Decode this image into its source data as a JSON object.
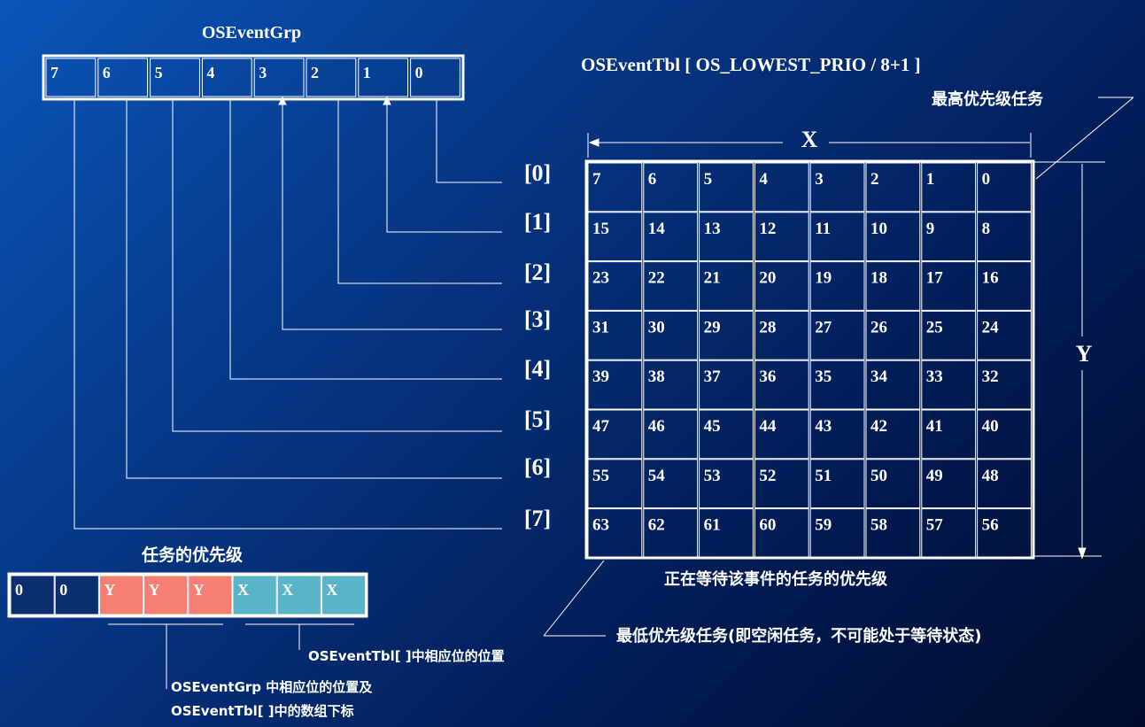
{
  "grp": {
    "title": "OSEventGrp",
    "bits": [
      "7",
      "6",
      "5",
      "4",
      "3",
      "2",
      "1",
      "0"
    ]
  },
  "tbl": {
    "title": "OSEventTbl [ OS_LOWEST_PRIO / 8+1 ]",
    "x_label": "X",
    "y_label": "Y",
    "row_labels": [
      "[0]",
      "[1]",
      "[2]",
      "[3]",
      "[4]",
      "[5]",
      "[6]",
      "[7]"
    ],
    "cells": [
      [
        "7",
        "6",
        "5",
        "4",
        "3",
        "2",
        "1",
        "0"
      ],
      [
        "15",
        "14",
        "13",
        "12",
        "11",
        "10",
        "9",
        "8"
      ],
      [
        "23",
        "22",
        "21",
        "20",
        "19",
        "18",
        "17",
        "16"
      ],
      [
        "31",
        "30",
        "29",
        "28",
        "27",
        "26",
        "25",
        "24"
      ],
      [
        "39",
        "38",
        "37",
        "36",
        "35",
        "34",
        "33",
        "32"
      ],
      [
        "47",
        "46",
        "45",
        "44",
        "43",
        "42",
        "41",
        "40"
      ],
      [
        "55",
        "54",
        "53",
        "52",
        "51",
        "50",
        "49",
        "48"
      ],
      [
        "63",
        "62",
        "61",
        "60",
        "59",
        "58",
        "57",
        "56"
      ]
    ],
    "highest_label": "最高优先级任务",
    "waiting_label": "正在等待该事件的任务的优先级",
    "lowest_label": "最低优先级任务(即空闲任务，不可能处于等待状态)"
  },
  "prio": {
    "title": "任务的优先级",
    "bits": [
      "0",
      "0",
      "Y",
      "Y",
      "Y",
      "X",
      "X",
      "X"
    ],
    "colors": {
      "zero": "#0b2f6e",
      "y": "#f47f72",
      "x": "#58b4c6"
    },
    "x_caption": "OSEventTbl[ ]中相应位的位置",
    "y_caption_1": "OSEventGrp 中相应位的位置及",
    "y_caption_2": "OSEventTbl[  ]中的数组下标"
  }
}
